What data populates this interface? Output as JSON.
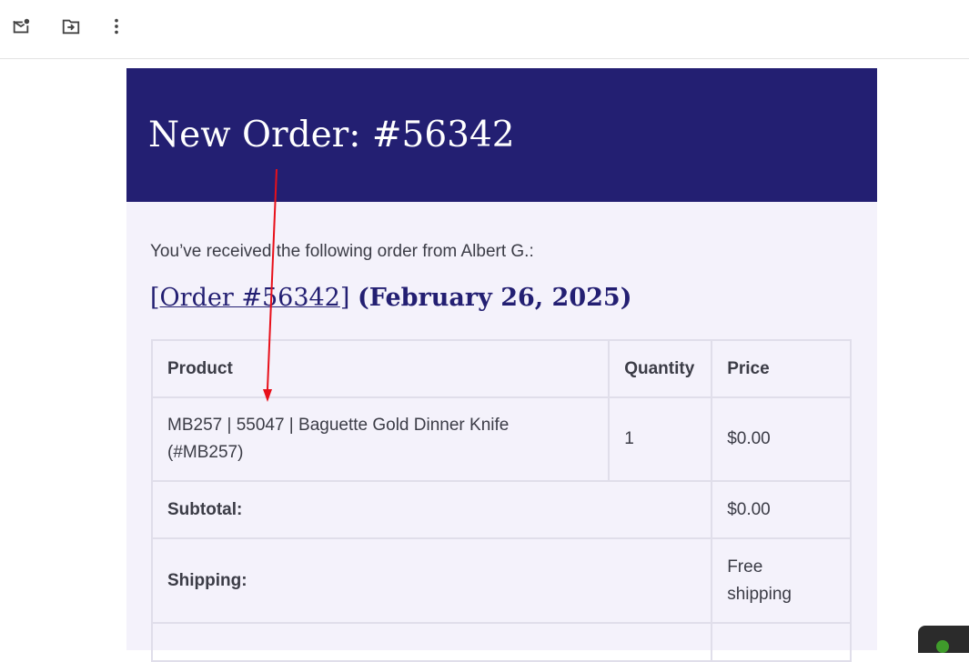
{
  "toolbar": {
    "icons": [
      "mark-unread-icon",
      "move-to-icon",
      "more-options-icon"
    ]
  },
  "email": {
    "header_title": "New Order: #56342",
    "intro": "You’ve received the following order from Albert G.:",
    "order_link": "Order #56342",
    "bracket_open": "[",
    "bracket_close": "]",
    "order_date": "(February 26, 2025)",
    "table": {
      "headers": [
        "Product",
        "Quantity",
        "Price"
      ],
      "item": {
        "product_line1": "MB257 | 55047 | Baguette Gold Dinner Knife",
        "product_line2": "(#MB257)",
        "quantity": "1",
        "price": "$0.00"
      },
      "subtotal_label": "Subtotal:",
      "subtotal_value": "$0.00",
      "shipping_label": "Shipping:",
      "shipping_value_line1": "Free",
      "shipping_value_line2": "shipping"
    }
  },
  "colors": {
    "header_bg": "#231f72",
    "body_bg": "#f4f2fb",
    "annotation_arrow": "#e8101a"
  }
}
